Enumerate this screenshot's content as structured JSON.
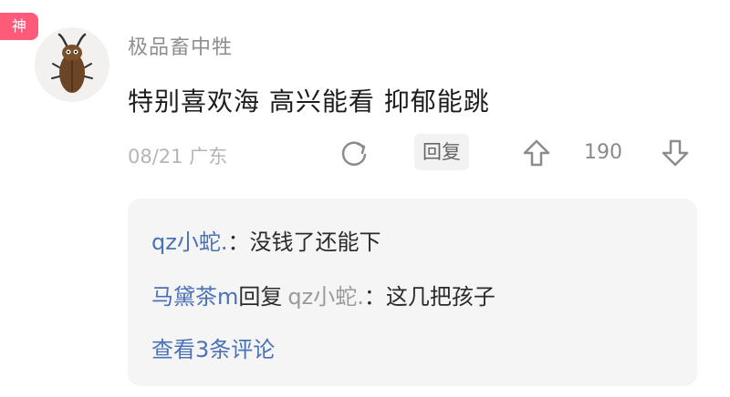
{
  "badge": "神",
  "comment": {
    "username": "极品畜中牲",
    "text": "特别喜欢海 高兴能看 抑郁能跳",
    "meta": "08/21 广东",
    "reply_label": "回复",
    "likes": "190"
  },
  "replies": [
    {
      "author": "qz小蛇.",
      "sep": "：",
      "text": "没钱了还能下"
    },
    {
      "author": "马黛茶m",
      "reply_word": "回复",
      "target": "qz小蛇.",
      "sep": "：",
      "text": "这几把孩子"
    }
  ],
  "view_more": "查看3条评论",
  "icons": {
    "avatar": "cockroach-cartoon-avatar",
    "share": "share-icon",
    "upvote": "upvote-arrow-icon",
    "downvote": "downvote-arrow-icon"
  },
  "colors": {
    "badge": "#ff5a7a",
    "link_blue": "#4a72b6",
    "reply_bg": "#f5f5f5"
  }
}
